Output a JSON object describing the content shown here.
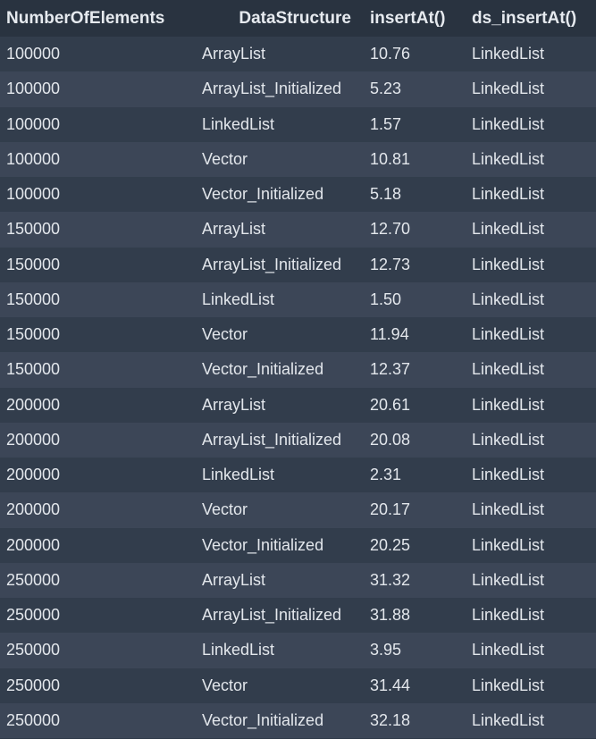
{
  "table": {
    "headers": [
      "NumberOfElements",
      "DataStructure",
      "insertAt()",
      "ds_insertAt()"
    ],
    "rows": [
      [
        "100000",
        "ArrayList",
        "10.76",
        "LinkedList"
      ],
      [
        "100000",
        "ArrayList_Initialized",
        "5.23",
        "LinkedList"
      ],
      [
        "100000",
        "LinkedList",
        "1.57",
        "LinkedList"
      ],
      [
        "100000",
        "Vector",
        "10.81",
        "LinkedList"
      ],
      [
        "100000",
        "Vector_Initialized",
        "5.18",
        "LinkedList"
      ],
      [
        "150000",
        "ArrayList",
        "12.70",
        "LinkedList"
      ],
      [
        "150000",
        "ArrayList_Initialized",
        "12.73",
        "LinkedList"
      ],
      [
        "150000",
        "LinkedList",
        "1.50",
        "LinkedList"
      ],
      [
        "150000",
        "Vector",
        "11.94",
        "LinkedList"
      ],
      [
        "150000",
        "Vector_Initialized",
        "12.37",
        "LinkedList"
      ],
      [
        "200000",
        "ArrayList",
        "20.61",
        "LinkedList"
      ],
      [
        "200000",
        "ArrayList_Initialized",
        "20.08",
        "LinkedList"
      ],
      [
        "200000",
        "LinkedList",
        "2.31",
        "LinkedList"
      ],
      [
        "200000",
        "Vector",
        "20.17",
        "LinkedList"
      ],
      [
        "200000",
        "Vector_Initialized",
        "20.25",
        "LinkedList"
      ],
      [
        "250000",
        "ArrayList",
        "31.32",
        "LinkedList"
      ],
      [
        "250000",
        "ArrayList_Initialized",
        "31.88",
        "LinkedList"
      ],
      [
        "250000",
        "LinkedList",
        "3.95",
        "LinkedList"
      ],
      [
        "250000",
        "Vector",
        "31.44",
        "LinkedList"
      ],
      [
        "250000",
        "Vector_Initialized",
        "32.18",
        "LinkedList"
      ]
    ]
  },
  "colors": {
    "header_bg": "#293340",
    "row_odd_bg": "#323d4c",
    "row_even_bg": "#3c4657",
    "text": "#e3e7ec"
  }
}
